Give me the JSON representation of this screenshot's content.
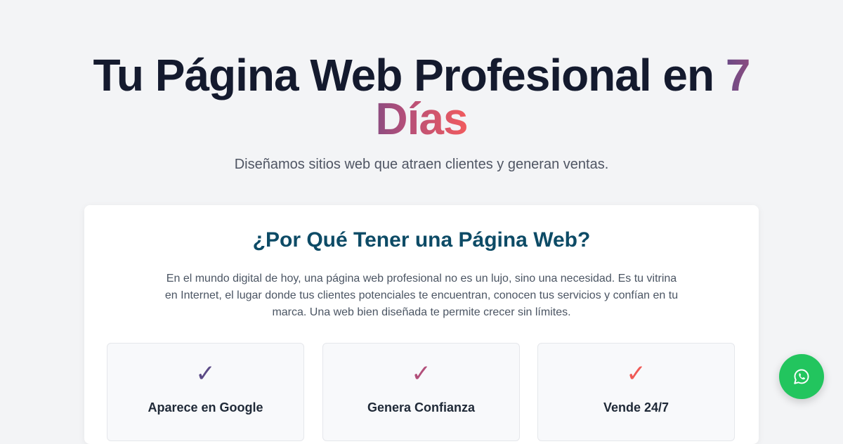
{
  "hero": {
    "title_main": "Tu Página Web Profesional en",
    "title_highlight": "7 Días",
    "subtitle": "Diseñamos sitios web que atraen clientes y generan ventas."
  },
  "section": {
    "title": "¿Por Qué Tener una Página Web?",
    "text": "En el mundo digital de hoy, una página web profesional no es un lujo, sino una necesidad. Es tu vitrina en Internet, el lugar donde tus clientes potenciales te encuentran, conocen tus servicios y confían en tu marca. Una web bien diseñada te permite crecer sin límites."
  },
  "features": [
    {
      "icon": "✓",
      "label": "Aparece en Google",
      "color": "#5b4a86"
    },
    {
      "icon": "✓",
      "label": "Genera Confianza",
      "color": "#b24f7a"
    },
    {
      "icon": "✓",
      "label": "Vende 24/7",
      "color": "#ef5a56"
    }
  ],
  "whatsapp": {
    "icon": "whatsapp-icon",
    "color": "#22c55e"
  }
}
